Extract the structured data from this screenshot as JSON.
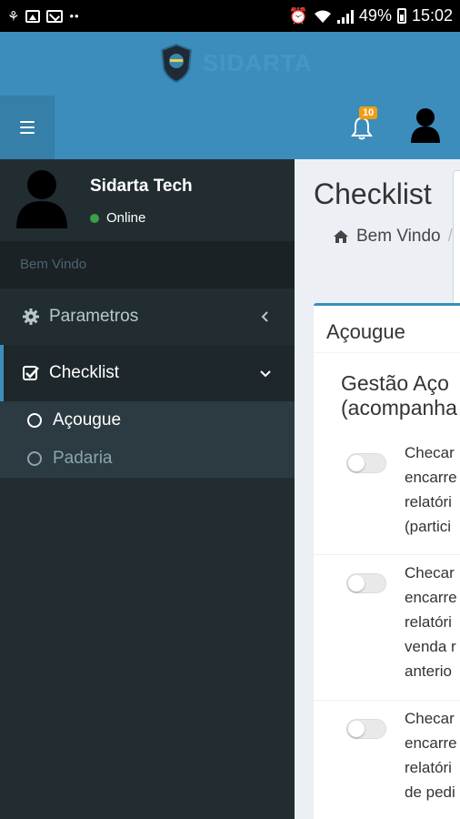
{
  "status_bar": {
    "battery": "49%",
    "time": "15:02"
  },
  "brand": {
    "name": "SIDARTA"
  },
  "navbar": {
    "notifications_count": "10"
  },
  "sidebar": {
    "user": {
      "name": "Sidarta Tech",
      "status": "Online"
    },
    "header": "Bem Vindo",
    "menu": [
      {
        "label": "Parametros"
      },
      {
        "label": "Checklist"
      }
    ],
    "submenu": [
      {
        "label": "Açougue"
      },
      {
        "label": "Padaria"
      }
    ]
  },
  "content": {
    "title": "Checklist",
    "breadcrumb": {
      "home": "Bem Vindo",
      "separator": "/"
    },
    "box_title": "Açougue",
    "section_title_line1": "Gestão Aço",
    "section_title_line2": "(acompanha",
    "items": [
      {
        "lines": [
          "Checar",
          "encarre",
          "relatóri",
          "(partici"
        ]
      },
      {
        "lines": [
          "Checar",
          "encarre",
          "relatóri",
          "venda r",
          "anterio"
        ]
      },
      {
        "lines": [
          "Checar",
          "encarre",
          "relatóri",
          "de pedi"
        ]
      }
    ]
  },
  "colors": {
    "header_blue": "#3c8dbc",
    "header_dark_blue": "#367fa9",
    "sidebar_bg": "#222d32",
    "content_bg": "#ecf0f5",
    "badge": "#f39c12",
    "online": "#3c9e47"
  },
  "icons": {
    "status_left": [
      "sync-icon",
      "image-icon",
      "mail-icon",
      "more-icon"
    ],
    "status_right": [
      "alarm-icon",
      "wifi-icon",
      "signal-icon",
      "battery-icon"
    ],
    "navbar": [
      "menu-icon",
      "bell-icon",
      "user-icon"
    ],
    "sidebar_menu": [
      "gear-icon",
      "checkbox-icon"
    ]
  }
}
